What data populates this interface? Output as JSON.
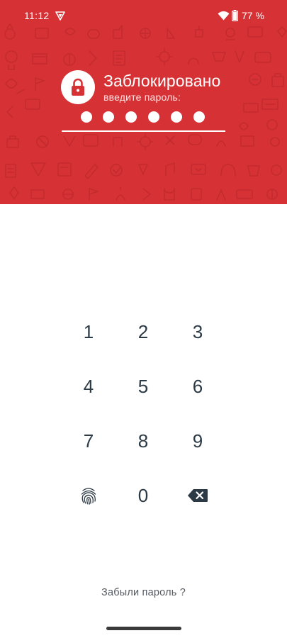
{
  "status_bar": {
    "time": "11:12",
    "battery_percent": "77 %",
    "icons": [
      "app-notification-icon",
      "wifi-icon",
      "battery-icon"
    ]
  },
  "lock_screen": {
    "title": "Заблокировано",
    "subtitle": "введите пароль:",
    "pin_length": 6,
    "lock_icon": "lock-icon"
  },
  "keypad": {
    "keys": [
      "1",
      "2",
      "3",
      "4",
      "5",
      "6",
      "7",
      "8",
      "9",
      "0"
    ],
    "fingerprint_icon": "fingerprint-icon",
    "backspace_icon": "backspace-icon"
  },
  "forgot_password": "Забыли пароль ?",
  "colors": {
    "header": "#d63236",
    "digits": "#2c3a45",
    "background": "#ffffff"
  }
}
